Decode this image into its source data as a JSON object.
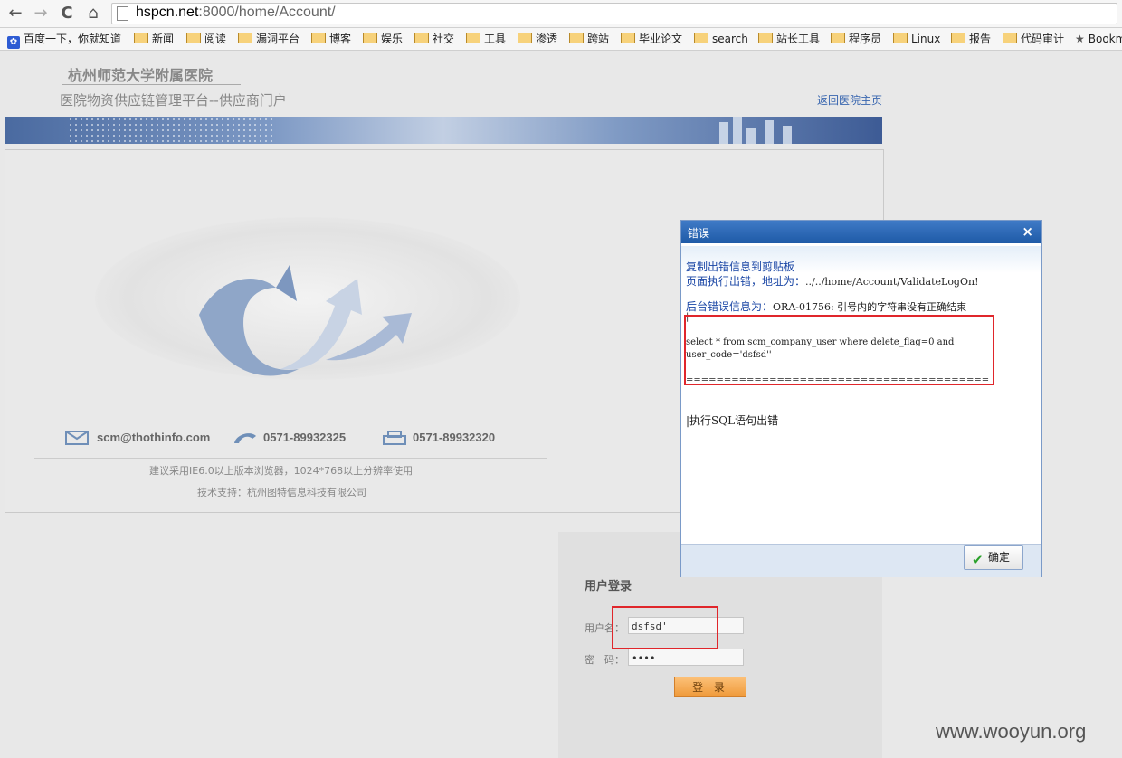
{
  "browser": {
    "url_host": "hspcn.net",
    "url_rest": ":8000/home/Account/",
    "nav": {
      "back": "←",
      "forward": "→",
      "reload": "C",
      "home": "⌂"
    },
    "bookmarks": [
      {
        "label": "百度一下，你就知道",
        "icon": "baidu-paw-icon"
      },
      {
        "label": "新闻",
        "icon": "folder-icon"
      },
      {
        "label": "阅读",
        "icon": "folder-icon"
      },
      {
        "label": "漏洞平台",
        "icon": "folder-icon"
      },
      {
        "label": "博客",
        "icon": "folder-icon"
      },
      {
        "label": "娱乐",
        "icon": "folder-icon"
      },
      {
        "label": "社交",
        "icon": "folder-icon"
      },
      {
        "label": "工具",
        "icon": "folder-icon"
      },
      {
        "label": "渗透",
        "icon": "folder-icon"
      },
      {
        "label": "跨站",
        "icon": "folder-icon"
      },
      {
        "label": "毕业论文",
        "icon": "folder-icon"
      },
      {
        "label": "search",
        "icon": "folder-icon"
      },
      {
        "label": "站长工具",
        "icon": "folder-icon"
      },
      {
        "label": "程序员",
        "icon": "folder-icon"
      },
      {
        "label": "Linux",
        "icon": "folder-icon"
      },
      {
        "label": "报告",
        "icon": "folder-icon"
      },
      {
        "label": "代码审计",
        "icon": "folder-icon"
      },
      {
        "label": "Bookm",
        "icon": "star-icon"
      }
    ]
  },
  "header": {
    "hospital": "杭州师范大学附属医院",
    "platform": "医院物资供应链管理平台--供应商门户",
    "back_link": "返回医院主页"
  },
  "contact": {
    "email": "scm@thothinfo.com",
    "phone": "0571-89932325",
    "fax": "0571-89932320",
    "browser_note": "建议采用IE6.0以上版本浏览器，1024*768以上分辨率使用",
    "support": "技术支持：杭州图特信息科技有限公司"
  },
  "login": {
    "title": "用户登录",
    "username_label": "用户名：",
    "username_value": "dsfsd'",
    "password_label": "密　码：",
    "password_value": "••••",
    "submit_label": "登 录"
  },
  "dialog": {
    "title": "错误",
    "close": "×",
    "copy_link": "复制出错信息到剪贴板",
    "page_error_label": "页面执行出错，地址为：",
    "page_error_url": "../../home/Account/ValidateLogOn!",
    "backend_label": "后台错误信息为：",
    "backend_msg": "ORA-01756: 引号内的字符串没有正确结束",
    "sep_top": "|=======================================================",
    "sql_line1": "select * from scm_company_user where delete_flag=0 and",
    "sql_line2": "user_code='dsfsd''",
    "sep_bottom": "=======================================================",
    "exec_error": "|执行SQL语句出错",
    "ok_label": "确定"
  },
  "watermark": "www.wooyun.org",
  "colors": {
    "highlight_box": "#e0262b",
    "link": "#1a46a5",
    "title_bar": "#1e5aa7"
  }
}
